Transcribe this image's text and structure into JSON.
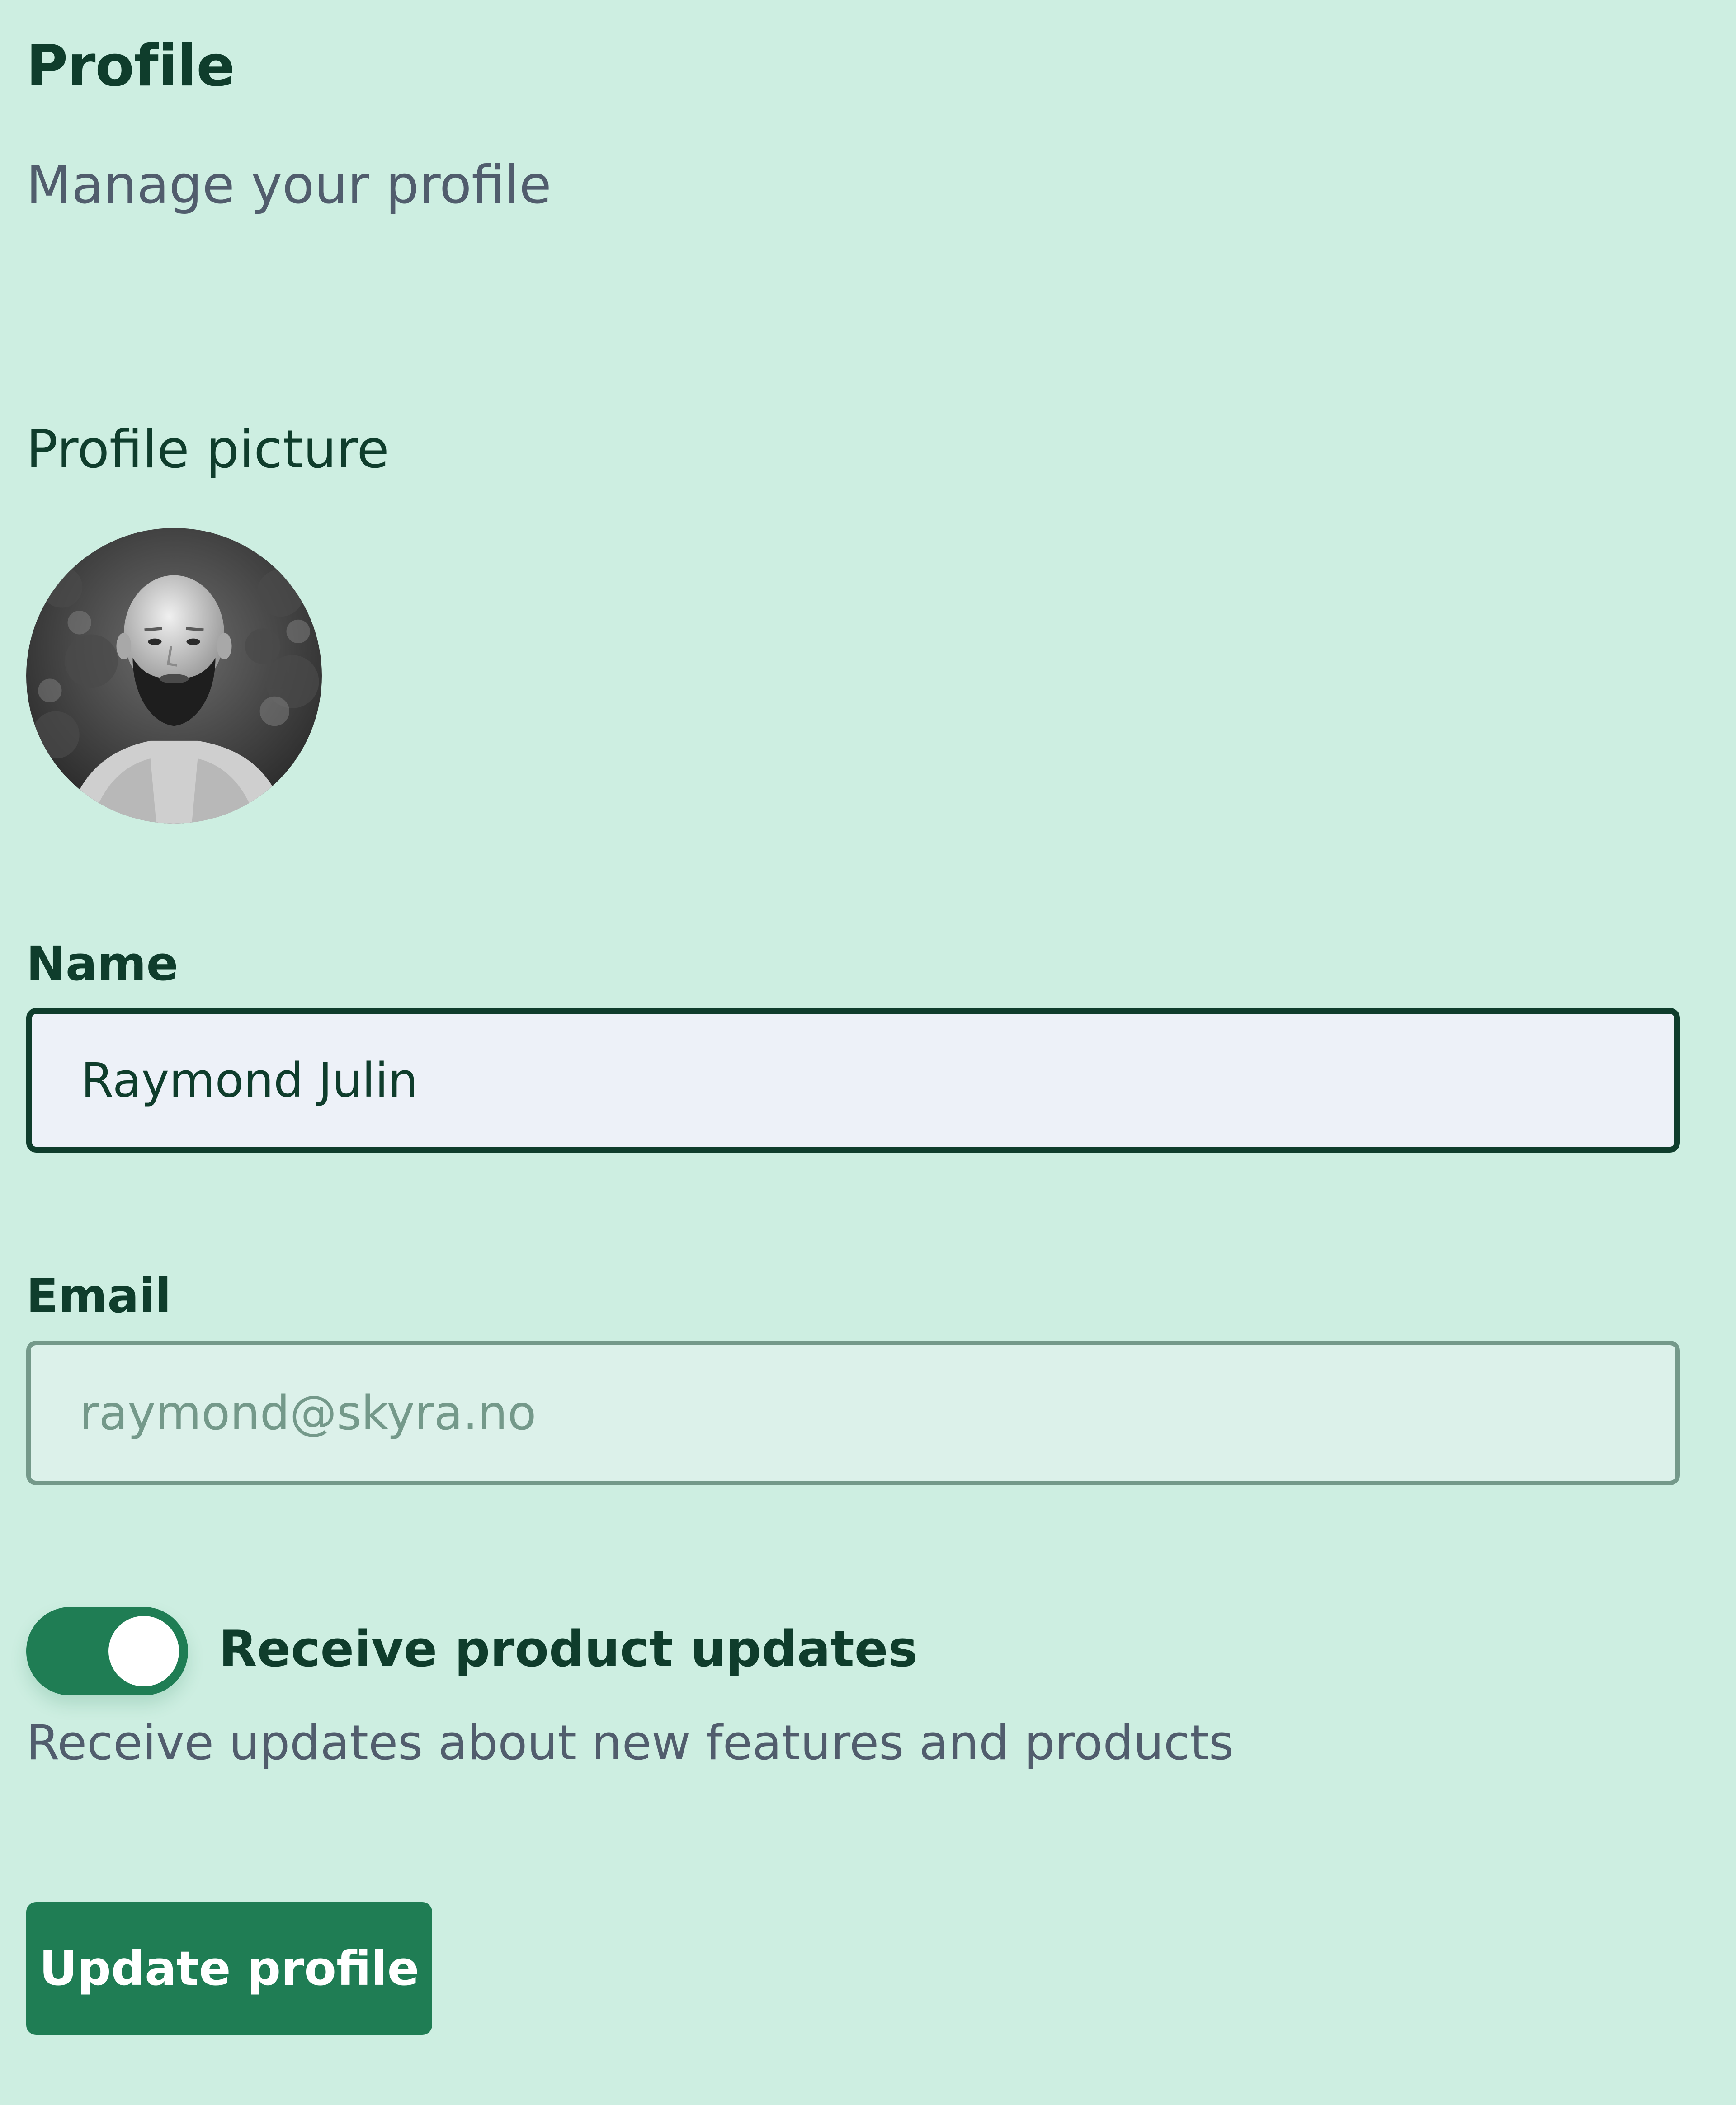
{
  "header": {
    "title": "Profile",
    "subtitle": "Manage your profile"
  },
  "profile_picture": {
    "label": "Profile picture",
    "icon": "avatar-photo"
  },
  "form": {
    "name": {
      "label": "Name",
      "value": "Raymond Julin"
    },
    "email": {
      "label": "Email",
      "placeholder": "raymond@skyra.no"
    }
  },
  "updates_toggle": {
    "label": "Receive product updates",
    "description": "Receive updates about new features and products",
    "enabled": true
  },
  "actions": {
    "update_label": "Update profile"
  },
  "colors": {
    "background": "#cdeee1",
    "primary": "#1f7d54",
    "text_dark": "#0f3d2c",
    "text_muted": "#515d6d",
    "input_bg": "#edf1f8",
    "input_disabled_bg": "#dcf1ea"
  }
}
